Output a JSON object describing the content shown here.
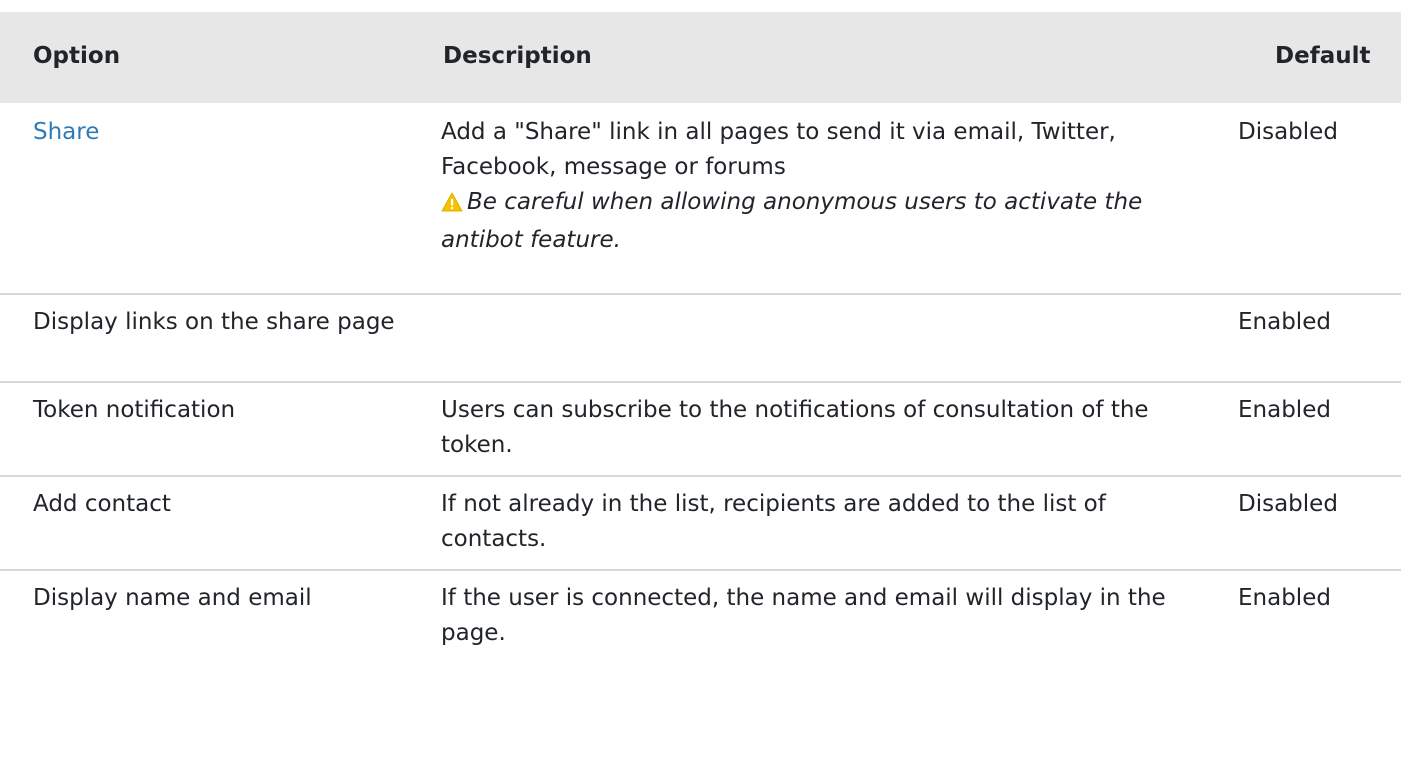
{
  "table": {
    "headers": {
      "option": "Option",
      "description": "Description",
      "default": "Default"
    },
    "rows": [
      {
        "option": "Share",
        "option_is_link": true,
        "description": "Add a \"Share\" link in all pages to send it via email, Twitter, Facebook, message or forums",
        "warning": "Be careful when allowing anonymous users to activate the antibot feature.",
        "default": "Disabled"
      },
      {
        "option": "Display links on the share page",
        "description": "",
        "default": "Enabled"
      },
      {
        "option": "Token notification",
        "description": "Users can subscribe to the notifications of consultation of the token.",
        "default": "Enabled"
      },
      {
        "option": "Add contact",
        "description": "If not already in the list, recipients are added to the list of contacts.",
        "default": "Disabled"
      },
      {
        "option": "Display name and email",
        "description": "If the user is connected, the name and email will display in the page.",
        "default": "Enabled"
      }
    ]
  },
  "colors": {
    "header_bg": "#e7e7e7",
    "link": "#2f7bb8",
    "warning_icon": "#f5c400",
    "row_border": "#d8d8d8"
  },
  "icons": {
    "warning": "warning-triangle-icon"
  }
}
